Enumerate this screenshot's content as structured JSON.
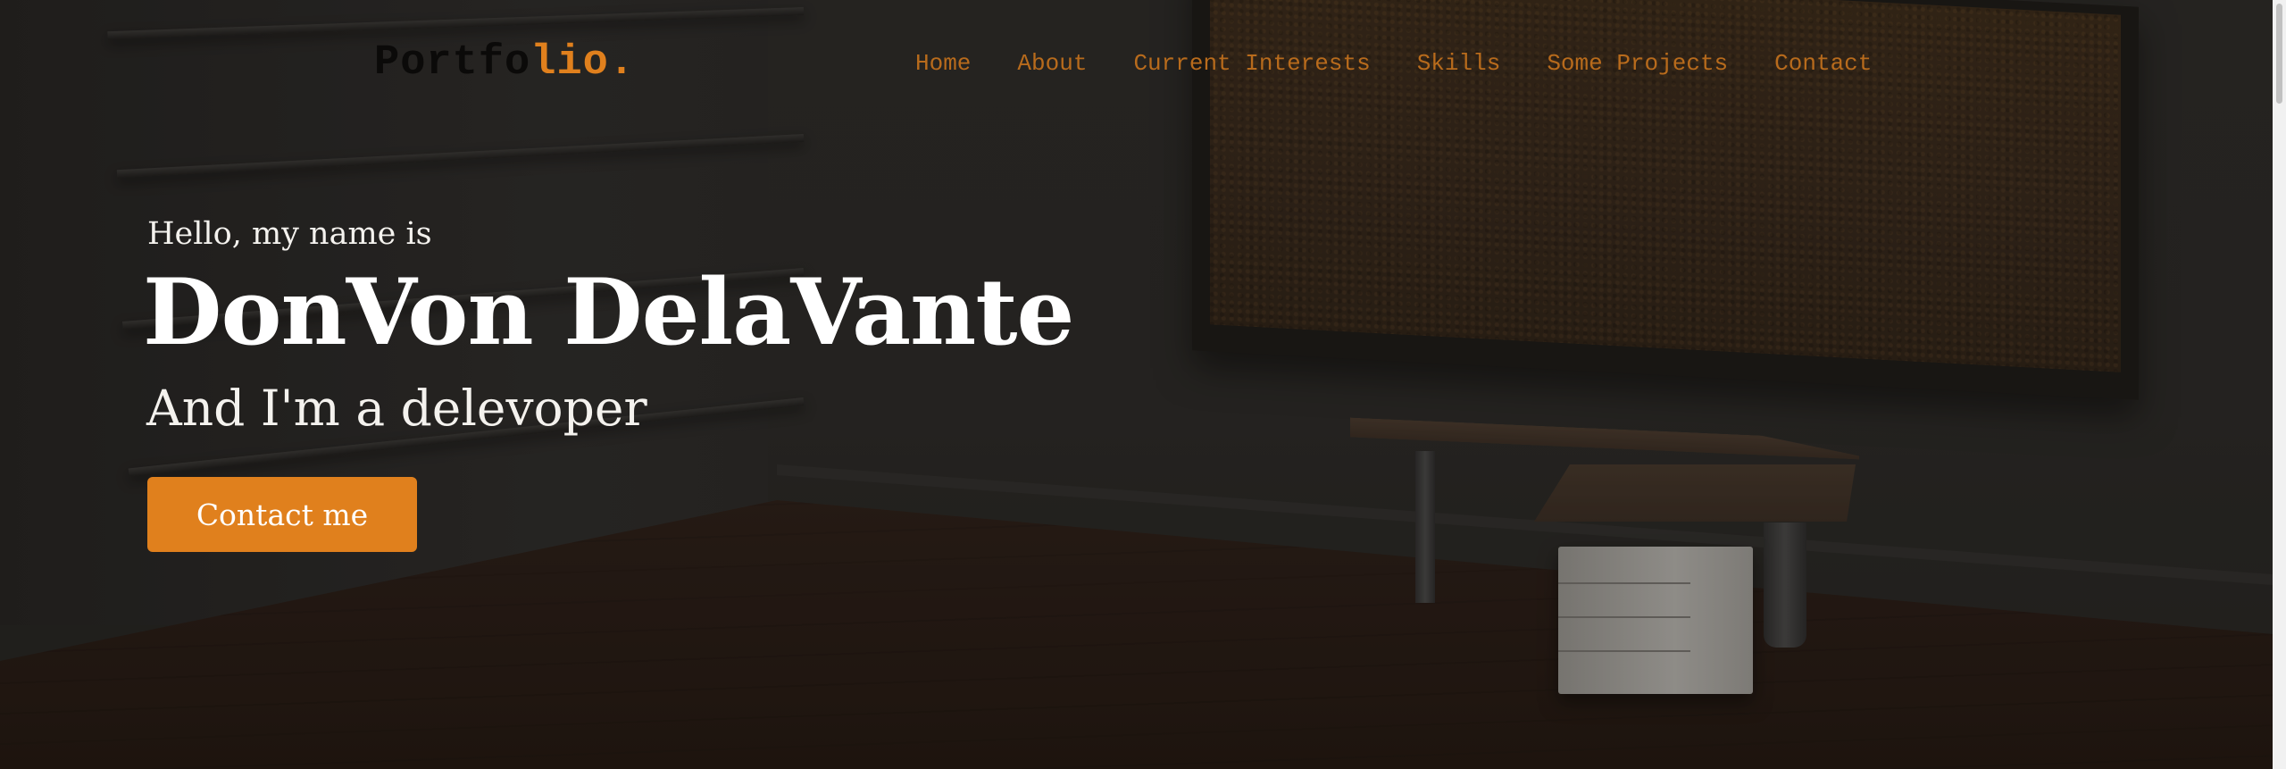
{
  "logo": {
    "part_dark": "Portfo",
    "part_accent": "lio."
  },
  "nav": {
    "items": [
      {
        "label": "Home"
      },
      {
        "label": "About"
      },
      {
        "label": "Current Interests"
      },
      {
        "label": "Skills"
      },
      {
        "label": "Some Projects"
      },
      {
        "label": "Contact"
      }
    ]
  },
  "hero": {
    "intro": "Hello, my name is",
    "name": "DonVon DelaVante",
    "role": "And I'm a delevoper",
    "cta_label": "Contact me"
  },
  "colors": {
    "accent": "#e0801d",
    "nav_link": "#b86b1c",
    "logo_dark": "#0b0a09",
    "hero_text": "#ffffff"
  }
}
